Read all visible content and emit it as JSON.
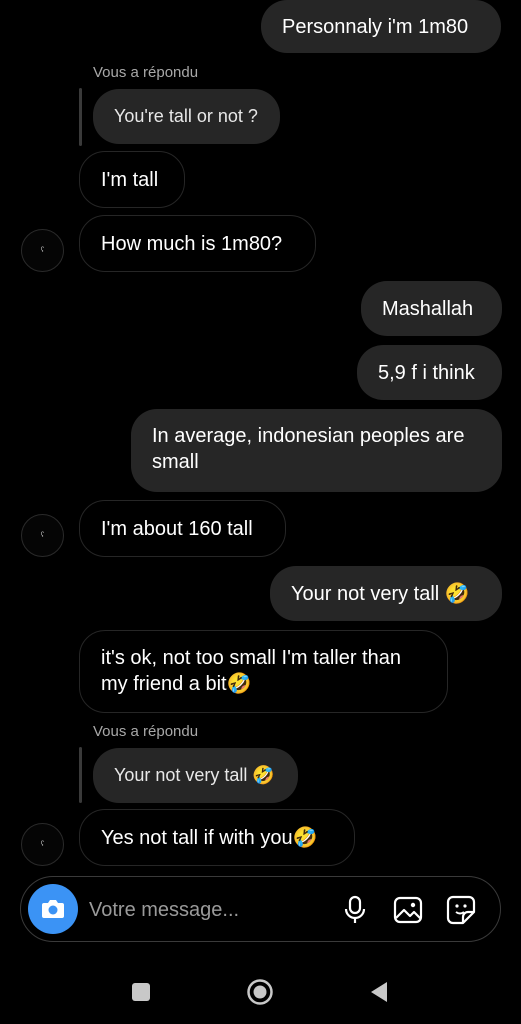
{
  "messages": {
    "m1": "Personnaly i'm 1m80",
    "reply1_label": "Vous a répondu",
    "reply1_quote": "You're tall or not ?",
    "m2": "I'm tall",
    "m3": "How much is 1m80?",
    "m4": "Mashallah",
    "m5": "5,9 f i think",
    "m6": "In average, indonesian peoples are small",
    "m7": "I'm about 160 tall",
    "m8": "Your not very tall 🤣",
    "m9": "it's ok, not too small I'm taller than my friend a bit🤣",
    "reply2_label": "Vous a répondu",
    "reply2_quote": "Your not very tall 🤣",
    "m10": "Yes not tall if with you🤣"
  },
  "avatar_glyph": "ʕ",
  "composer": {
    "placeholder": "Votre message...",
    "camera_icon": "camera-icon",
    "mic_icon": "microphone-icon",
    "gallery_icon": "image-icon",
    "sticker_icon": "sticker-icon"
  },
  "navbar": {
    "recents_icon": "square-icon",
    "home_icon": "circle-icon",
    "back_icon": "triangle-back-icon"
  },
  "colors": {
    "background": "#000000",
    "outgoing_bubble": "#262626",
    "incoming_border": "#262626",
    "camera_button": "#3b93f5",
    "secondary_text": "#a8a8a8"
  }
}
